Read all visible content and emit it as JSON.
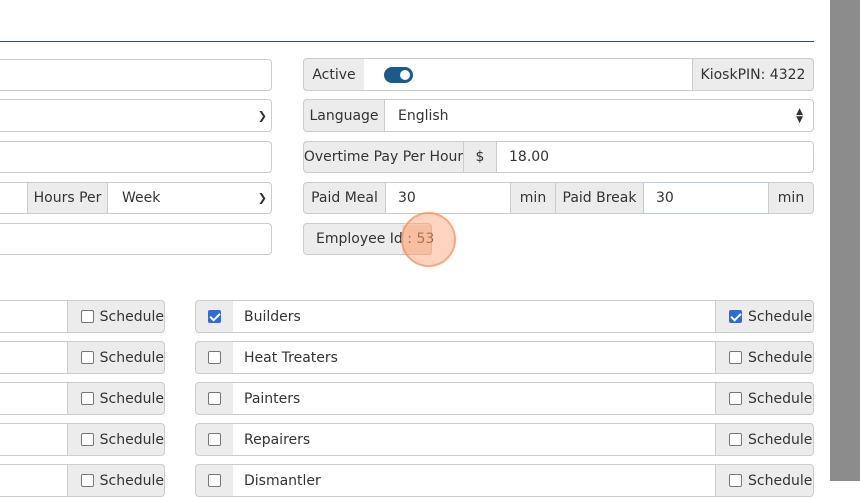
{
  "form": {
    "active_label": "Active",
    "active_on": true,
    "kiosk_pin": "KioskPIN: 4322",
    "language_label": "Language",
    "language_value": "English",
    "overtime_label": "Overtime Pay Per Hour",
    "currency_symbol": "$",
    "overtime_value": "18.00",
    "hours_per_label": "Hours Per",
    "hours_per_value": "Week",
    "paid_meal_label": "Paid Meal",
    "paid_meal_value": "30",
    "paid_meal_unit": "min",
    "paid_break_label": "Paid Break",
    "paid_break_value": "30",
    "paid_break_unit": "min",
    "employee_id_label": "Employee Id :",
    "employee_id_value": "53"
  },
  "schedule_label": "Schedule",
  "left_groups": [
    {
      "schedule": false
    },
    {
      "schedule": false
    },
    {
      "schedule": false
    },
    {
      "schedule": false
    },
    {
      "schedule": false
    }
  ],
  "groups": [
    {
      "name": "Builders",
      "checked": true,
      "schedule": true
    },
    {
      "name": "Heat Treaters",
      "checked": false,
      "schedule": false
    },
    {
      "name": "Painters",
      "checked": false,
      "schedule": false
    },
    {
      "name": "Repairers",
      "checked": false,
      "schedule": false
    },
    {
      "name": "Dismantler",
      "checked": false,
      "schedule": false
    }
  ],
  "colors": {
    "accent": "#1a5b8c",
    "checkbox": "#2f6bd8",
    "rule": "#1f4e79"
  }
}
